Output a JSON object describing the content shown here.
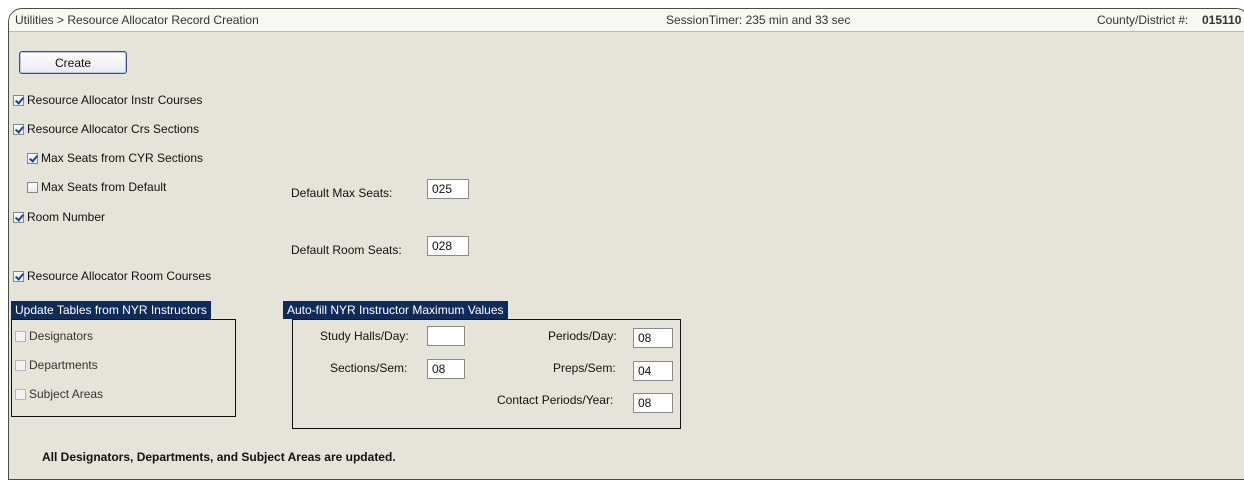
{
  "header": {
    "breadcrumb": "Utilities > Resource Allocator Record Creation",
    "session_timer": "SessionTimer: 235 min and 33 sec",
    "district_label": "County/District #:",
    "district_value": "015110"
  },
  "actions": {
    "create_label": "Create"
  },
  "options": [
    {
      "label": "Resource Allocator Instr Courses",
      "checked": true
    },
    {
      "label": "Resource Allocator Crs Sections",
      "checked": true
    },
    {
      "label": "Max Seats from CYR Sections",
      "checked": true
    },
    {
      "label": "Max Seats from Default",
      "checked": false
    },
    {
      "label": "Room Number",
      "checked": true
    },
    {
      "label": "Resource Allocator Room Courses",
      "checked": true
    }
  ],
  "defaults": {
    "max_seats_label": "Default Max Seats:",
    "max_seats_value": "025",
    "room_seats_label": "Default Room Seats:",
    "room_seats_value": "028"
  },
  "update_panel": {
    "title": "Update Tables from NYR Instructors",
    "items": [
      {
        "label": "Designators",
        "checked": false
      },
      {
        "label": "Departments",
        "checked": false
      },
      {
        "label": "Subject Areas",
        "checked": false
      }
    ]
  },
  "autofill_panel": {
    "title": "Auto-fill NYR Instructor Maximum Values",
    "study_halls_label": "Study Halls/Day:",
    "study_halls_value": "",
    "sections_label": "Sections/Sem:",
    "sections_value": "08",
    "periods_label": "Periods/Day:",
    "periods_value": "08",
    "preps_label": "Preps/Sem:",
    "preps_value": "04",
    "contact_label": "Contact Periods/Year:",
    "contact_value": "08"
  },
  "footer_note": "All Designators, Departments, and Subject Areas are updated."
}
